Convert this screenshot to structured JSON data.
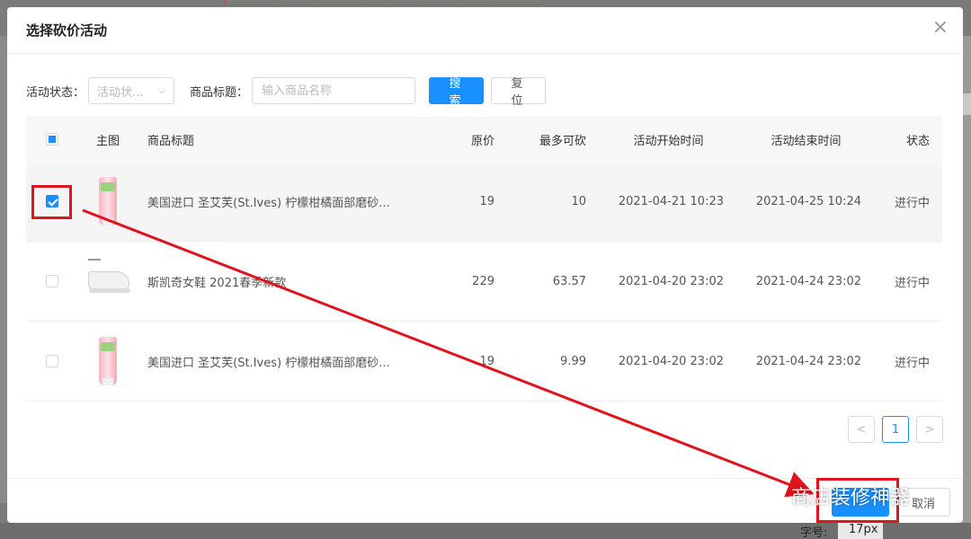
{
  "modal": {
    "title": "选择砍价活动",
    "close_icon": "×"
  },
  "filters": {
    "status_label": "活动状态：",
    "status_placeholder": "活动状...",
    "title_label": "商品标题：",
    "title_placeholder": "输入商品名称",
    "search_button": "搜索",
    "reset_button": "复位"
  },
  "table": {
    "headers": {
      "image": "主图",
      "title": "商品标题",
      "price": "原价",
      "max_cut": "最多可砍",
      "start": "活动开始时间",
      "end": "活动结束时间",
      "status": "状态"
    },
    "rows": [
      {
        "checked": true,
        "image": "tube",
        "title": "美国进口 圣艾芙(St.Ives) 柠檬柑橘面部磨砂...",
        "price": "19",
        "max_cut": "10",
        "start": "2021-04-21 10:23",
        "end": "2021-04-25 10:24",
        "status": "进行中"
      },
      {
        "checked": false,
        "image": "shoe",
        "title": "斯凯奇女鞋 2021春季新款",
        "price": "229",
        "max_cut": "63.57",
        "start": "2021-04-20 23:02",
        "end": "2021-04-24 23:02",
        "status": "进行中"
      },
      {
        "checked": false,
        "image": "tube",
        "title": "美国进口 圣艾芙(St.Ives) 柠檬柑橘面部磨砂...",
        "price": "19",
        "max_cut": "9.99",
        "start": "2021-04-20 23:02",
        "end": "2021-04-24 23:02",
        "status": "进行中"
      }
    ]
  },
  "pagination": {
    "prev": "<",
    "current": "1",
    "next": ">"
  },
  "footer": {
    "cancel_fragment": "取消"
  },
  "watermark": {
    "text": "商店装修神器"
  },
  "bottom_bar": {
    "label": "字号:",
    "value": "17px"
  },
  "colors": {
    "primary": "#1890ff",
    "annotation": "#e0141e"
  }
}
